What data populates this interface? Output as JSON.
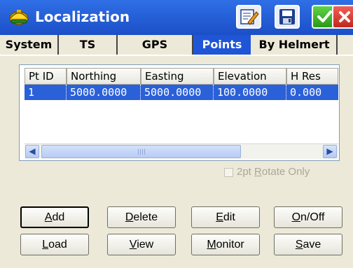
{
  "window": {
    "title": "Localization",
    "icon": "helmet-icon"
  },
  "title_buttons": {
    "edit_icon": "edit-notepad-icon",
    "save_icon": "save-disk-icon",
    "ok_icon": "checkmark-icon",
    "close_icon": "close-x-icon"
  },
  "tabs": [
    {
      "label": "System",
      "active": false
    },
    {
      "label": "TS",
      "active": false
    },
    {
      "label": "GPS",
      "active": false
    },
    {
      "label": "Points",
      "active": true
    },
    {
      "label": "By Helmert",
      "active": false
    }
  ],
  "table": {
    "columns": [
      "Pt ID",
      "Northing",
      "Easting",
      "Elevation",
      "H Res"
    ],
    "rows": [
      {
        "pt_id": "1",
        "northing": "5000.0000",
        "easting": "5000.0000",
        "elevation": "100.0000",
        "h_res": "0.000",
        "selected": true
      }
    ]
  },
  "scrollbar": {
    "left_arrow": "◀",
    "right_arrow": "▶"
  },
  "options": {
    "rotate_label_pre": "2pt ",
    "rotate_label_accel": "R",
    "rotate_label_post": "otate Only",
    "rotate_checked": false,
    "rotate_enabled": false
  },
  "buttons": {
    "add": {
      "accel": "A",
      "rest": "dd"
    },
    "delete": {
      "accel": "D",
      "rest": "elete"
    },
    "edit": {
      "accel": "E",
      "rest": "dit"
    },
    "onoff": {
      "accel": "O",
      "rest": "n/Off"
    },
    "load": {
      "accel": "L",
      "rest": "oad"
    },
    "view": {
      "accel": "V",
      "rest": "iew"
    },
    "monitor": {
      "accel": "M",
      "rest": "onitor"
    },
    "save": {
      "accel": "S",
      "rest": "ave"
    }
  },
  "colors": {
    "titlebar": "#2f6fe6",
    "active_tab": "#1f55d6",
    "selection": "#2a60d8",
    "ok_green": "#2a9a17",
    "close_red": "#c2281c"
  }
}
